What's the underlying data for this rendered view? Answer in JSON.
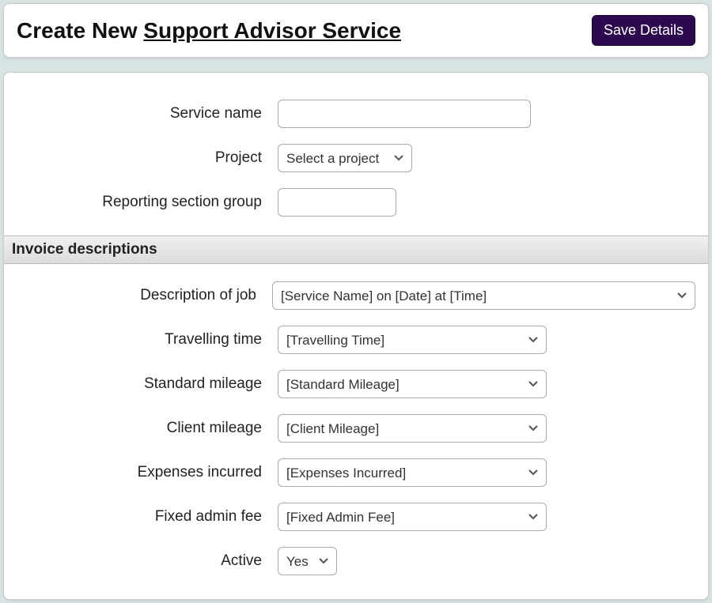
{
  "header": {
    "prefix": "Create New ",
    "emphasis": "Support Advisor Service",
    "save_label": "Save Details"
  },
  "fields": {
    "service_name": {
      "label": "Service name",
      "value": ""
    },
    "project": {
      "label": "Project",
      "selected": "Select a project"
    },
    "reporting_group": {
      "label": "Reporting section group",
      "value": ""
    }
  },
  "section": {
    "invoice_descriptions": "Invoice descriptions"
  },
  "invoice": {
    "description_of_job": {
      "label": "Description of job",
      "selected": "[Service Name] on [Date] at [Time]"
    },
    "travelling_time": {
      "label": "Travelling time",
      "selected": "[Travelling Time]"
    },
    "standard_mileage": {
      "label": "Standard mileage",
      "selected": "[Standard Mileage]"
    },
    "client_mileage": {
      "label": "Client mileage",
      "selected": "[Client Mileage]"
    },
    "expenses_incurred": {
      "label": "Expenses incurred",
      "selected": "[Expenses Incurred]"
    },
    "fixed_admin_fee": {
      "label": "Fixed admin fee",
      "selected": "[Fixed Admin Fee]"
    },
    "active": {
      "label": "Active",
      "selected": "Yes"
    }
  }
}
